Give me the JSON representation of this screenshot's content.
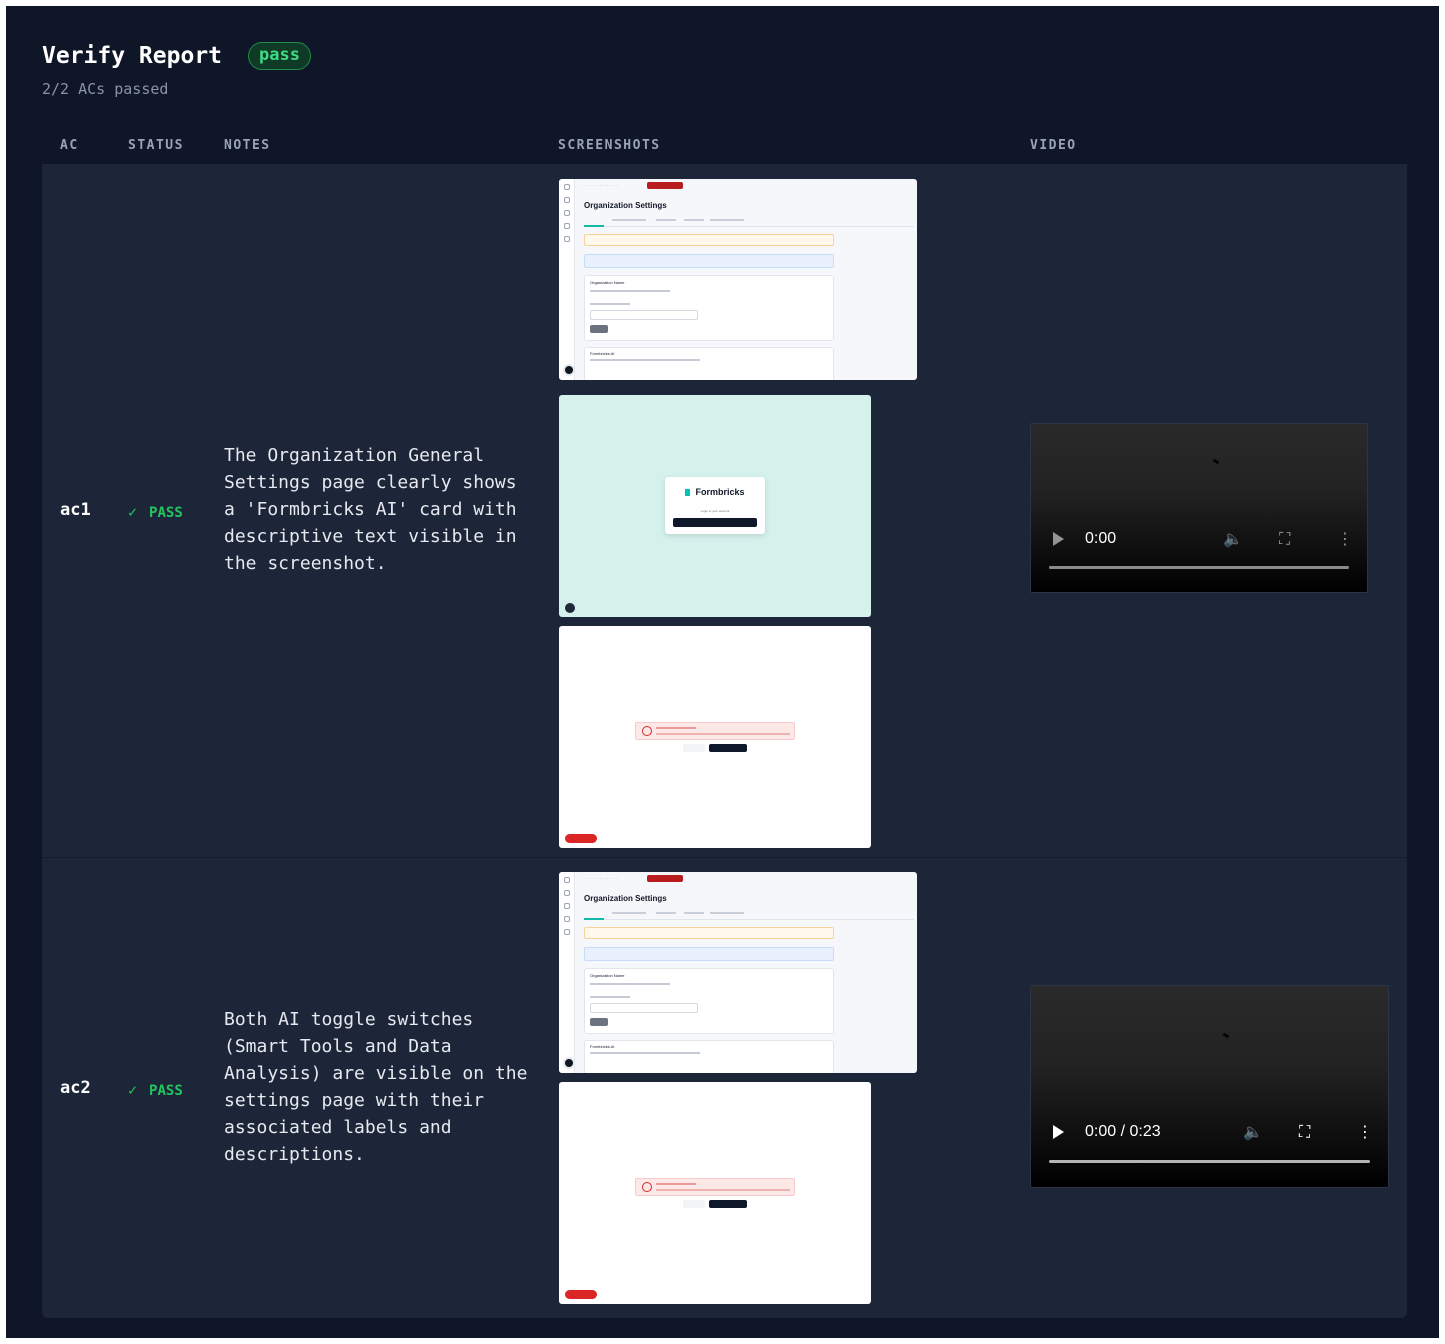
{
  "report": {
    "title": "Verify Report",
    "badge": "pass",
    "summary": "2/2 ACs passed"
  },
  "table": {
    "columns": [
      "AC",
      "STATUS",
      "NOTES",
      "SCREENSHOTS",
      "VIDEO"
    ],
    "rows": [
      {
        "id": "ac1",
        "status_icon": "✓",
        "status": "PASS",
        "notes": "The Organization General Settings page clearly shows a 'Formbricks AI' card with descriptive text visible in the screenshot.",
        "screenshots": [
          {
            "heading": "Organization Settings",
            "card_title": "Organization Name",
            "card2_title": "Formbricks AI"
          },
          {
            "brand": "Formbricks",
            "subtitle": "Login to your account"
          },
          {
            "kind": "error"
          }
        ],
        "video": {
          "time": "0:00"
        }
      },
      {
        "id": "ac2",
        "status_icon": "✓",
        "status": "PASS",
        "notes": "Both AI toggle switches (Smart Tools and Data Analysis) are visible on the settings page with their associated labels and descriptions.",
        "screenshots": [
          {
            "heading": "Organization Settings",
            "card_title": "Organization Name",
            "card2_title": "Formbricks AI"
          },
          {
            "kind": "error"
          }
        ],
        "video": {
          "time": "0:00 / 0:23"
        }
      }
    ]
  },
  "icons": {
    "volume": "volume-icon",
    "fullscreen": "fullscreen-icon",
    "more": "more-vertical-icon",
    "play": "play-icon"
  },
  "colors": {
    "background": "#0f1628",
    "row": "#1d2638",
    "pass": "#22c55e",
    "badge_text": "#3ddc84"
  }
}
